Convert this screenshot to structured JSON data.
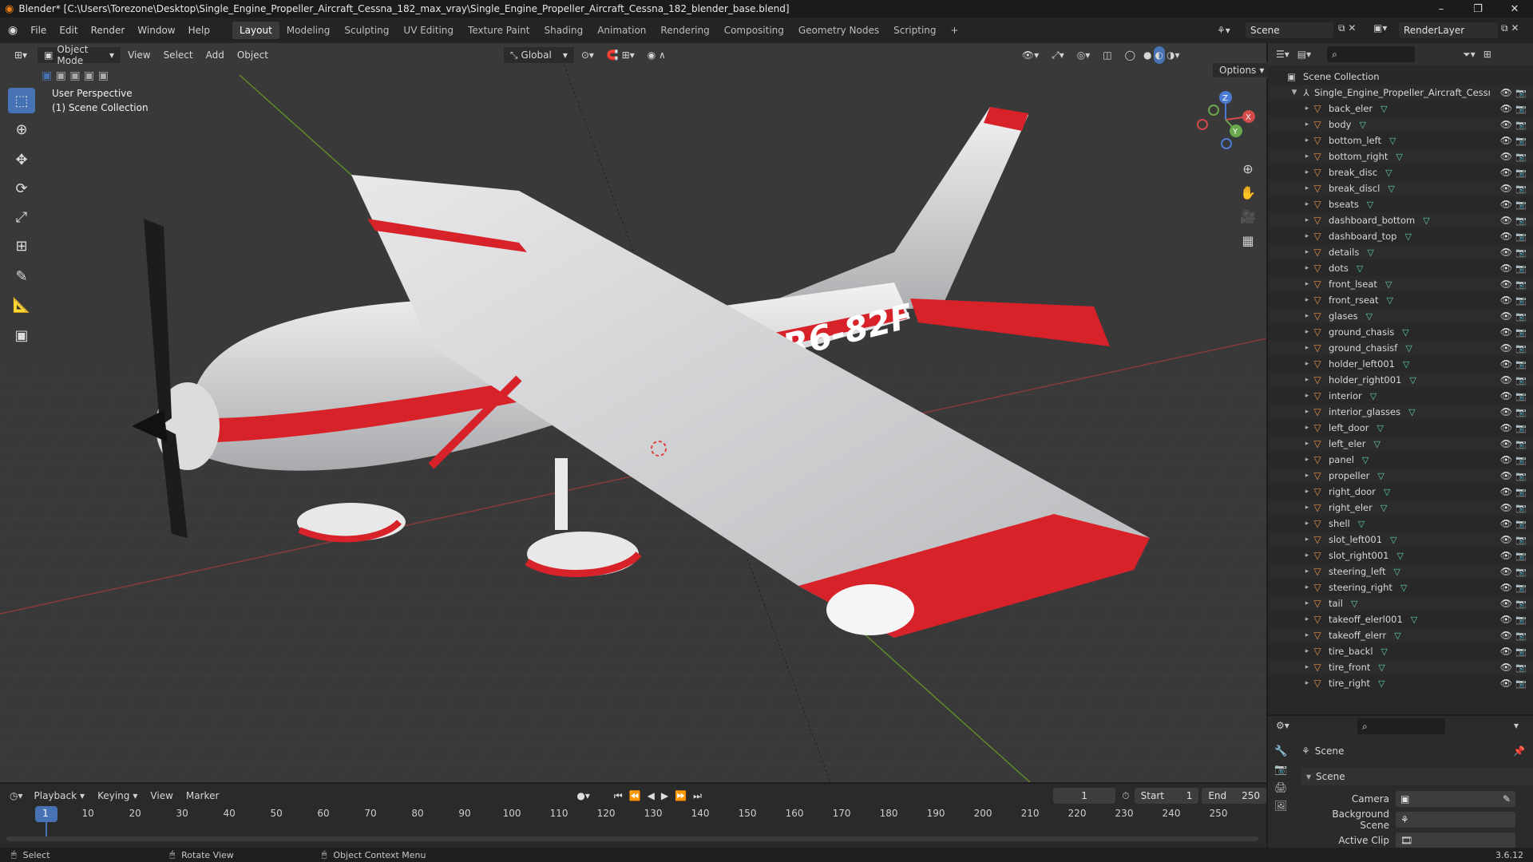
{
  "window": {
    "title": "Blender* [C:\\Users\\Torezone\\Desktop\\Single_Engine_Propeller_Aircraft_Cessna_182_max_vray\\Single_Engine_Propeller_Aircraft_Cessna_182_blender_base.blend]",
    "minimize": "–",
    "maximize": "❐",
    "close": "✕"
  },
  "menu": {
    "items": [
      "File",
      "Edit",
      "Render",
      "Window",
      "Help"
    ],
    "workspaces": [
      "Layout",
      "Modeling",
      "Sculpting",
      "UV Editing",
      "Texture Paint",
      "Shading",
      "Animation",
      "Rendering",
      "Compositing",
      "Geometry Nodes",
      "Scripting",
      "+"
    ],
    "active_workspace": "Layout",
    "scene_label": "Scene",
    "render_layer_label": "RenderLayer"
  },
  "viewport": {
    "mode": "Object Mode",
    "menus": [
      "View",
      "Select",
      "Add",
      "Object"
    ],
    "transform_orientation": "Global",
    "options_label": "Options",
    "perspective_label": "User Perspective",
    "collection_label": "(1) Scene Collection",
    "aircraft_registration": "R6-82F",
    "gizmo_axes": [
      "X",
      "Y",
      "Z"
    ]
  },
  "outliner": {
    "root": "Scene Collection",
    "collection": "Single_Engine_Propeller_Aircraft_Cessna",
    "objects": [
      "back_eler",
      "body",
      "bottom_left",
      "bottom_right",
      "break_disc",
      "break_discl",
      "bseats",
      "dashboard_bottom",
      "dashboard_top",
      "details",
      "dots",
      "front_lseat",
      "front_rseat",
      "glases",
      "ground_chasis",
      "ground_chasisf",
      "holder_left001",
      "holder_right001",
      "interior",
      "interior_glasses",
      "left_door",
      "left_eler",
      "panel",
      "propeller",
      "right_door",
      "right_eler",
      "shell",
      "slot_left001",
      "slot_right001",
      "steering_left",
      "steering_right",
      "tail",
      "takeoff_elerl001",
      "takeoff_elerr",
      "tire_backl",
      "tire_front",
      "tire_right"
    ]
  },
  "properties": {
    "header": "Scene",
    "panel": "Scene",
    "fields": [
      {
        "label": "Camera",
        "value": ""
      },
      {
        "label": "Background Scene",
        "value": ""
      },
      {
        "label": "Active Clip",
        "value": ""
      }
    ]
  },
  "timeline": {
    "menus": [
      "Playback",
      "Keying",
      "View",
      "Marker"
    ],
    "current_frame": "1",
    "start_label": "Start",
    "start": "1",
    "end_label": "End",
    "end": "250",
    "ticks": [
      "1",
      "10",
      "20",
      "30",
      "40",
      "50",
      "60",
      "70",
      "80",
      "90",
      "100",
      "110",
      "120",
      "130",
      "140",
      "150",
      "160",
      "170",
      "180",
      "190",
      "200",
      "210",
      "220",
      "230",
      "240",
      "250"
    ]
  },
  "statusbar": {
    "items": [
      "Select",
      "Rotate View",
      "Object Context Menu"
    ],
    "version": "3.6.12"
  },
  "colors": {
    "accent": "#4772b3",
    "viewport_bg": "#393939",
    "aircraft_red": "#d8222a",
    "mesh_icon": "#e3904a"
  }
}
